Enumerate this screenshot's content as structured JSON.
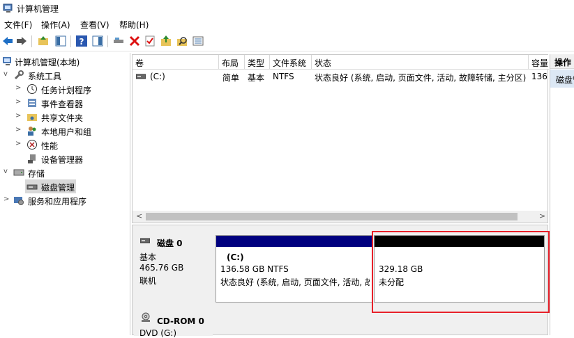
{
  "window": {
    "title": "计算机管理"
  },
  "menu": {
    "items": [
      "文件(F)",
      "操作(A)",
      "查看(V)",
      "帮助(H)"
    ]
  },
  "tree": {
    "root": "计算机管理(本地)",
    "system_tools": "系统工具",
    "task_scheduler": "任务计划程序",
    "event_viewer": "事件查看器",
    "shared_folders": "共享文件夹",
    "local_users": "本地用户和组",
    "performance": "性能",
    "device_manager": "设备管理器",
    "storage": "存储",
    "disk_management": "磁盘管理",
    "services_apps": "服务和应用程序"
  },
  "volume_table": {
    "columns": [
      "卷",
      "布局",
      "类型",
      "文件系统",
      "状态",
      "容量"
    ],
    "rows": [
      {
        "volume": "(C:)",
        "layout": "简单",
        "type": "基本",
        "fs": "NTFS",
        "status": "状态良好 (系统, 启动, 页面文件, 活动, 故障转储, 主分区)",
        "capacity": "136"
      }
    ]
  },
  "disks": {
    "disk0": {
      "name": "磁盘 0",
      "kind": "基本",
      "size": "465.76 GB",
      "state": "联机",
      "partitions": [
        {
          "label": "(C:)",
          "size": "136.58 GB NTFS",
          "status": "状态良好 (系统, 启动, 页面文件, 活动, 故",
          "color": "#00007f"
        },
        {
          "label": "",
          "size": "329.18 GB",
          "status": "未分配",
          "color": "#000000"
        }
      ]
    },
    "cdrom0": {
      "name": "CD-ROM 0",
      "kind": "DVD (G:)"
    }
  },
  "actions": {
    "header": "操作",
    "item": "磁盘管"
  },
  "colors": {
    "highlight": "#e8202a",
    "selection": "#d9d9d9",
    "primary_partition": "#00007f",
    "unallocated": "#000000"
  }
}
